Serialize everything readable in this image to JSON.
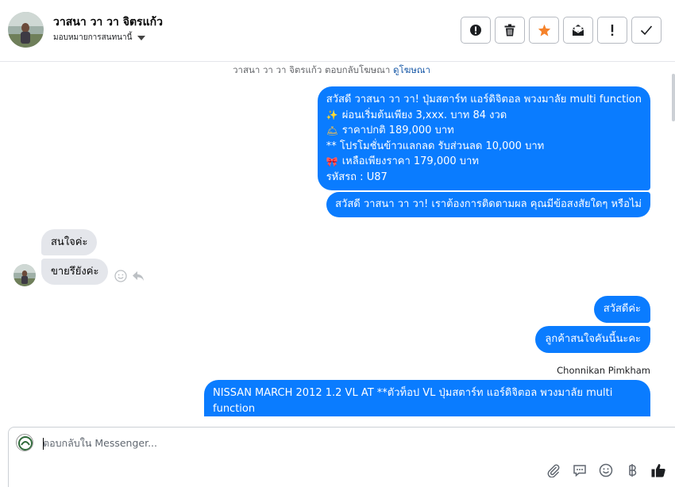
{
  "header": {
    "contact_name": "วาสนา วา วา จิตรแก้ว",
    "assign_label": "มอบหมายการสนทนานี้",
    "toolbar": [
      {
        "name": "report-spam-button",
        "icon": "alert-circle-icon"
      },
      {
        "name": "delete-button",
        "icon": "trash-icon"
      },
      {
        "name": "star-button",
        "icon": "star-icon"
      },
      {
        "name": "mark-unread-button",
        "icon": "envelope-icon"
      },
      {
        "name": "follow-up-button",
        "icon": "exclamation-icon"
      },
      {
        "name": "mark-done-button",
        "icon": "check-icon"
      }
    ]
  },
  "chat": {
    "ad_notice": {
      "text": "วาสนา วา วา จิตรแก้ว ตอบกลับโฆษณา ",
      "link": "ดูโฆษณา"
    },
    "messages": {
      "m1": {
        "lines": [
          "สวัสดี วาสนา วา วา! ปุ่มสตาร์ท แอร์ดิจิตอล พวงมาลัย multi function",
          "ผ่อนเริ่มต้นเพียง 3,xxx. บาท 84 งวด",
          "ราคาปกติ 189,000 บาท",
          "** โปรโมชั่นข้าวแลกลด รับส่วนลด 10,000 บาท",
          " เหลือเพียงราคา 179,000 บาท",
          " รหัสรถ : U87"
        ],
        "emoji": [
          "✨",
          "🛎",
          "🎀"
        ]
      },
      "m2": "สวัสดี วาสนา วา วา! เราต้องการติดตามผล คุณมีข้อสงสัยใดๆ หรือไม่",
      "m3": "สนใจค่ะ",
      "m4": "ขายรึยังค่ะ",
      "m5": "สวัสดีค่ะ",
      "m6": "ลูกค้าสนใจคันนี้นะคะ",
      "sender_label": "Chonnikan Pimkham",
      "m7": "NISSAN MARCH 2012 1.2 VL AT **ตัวท็อป VL ปุ่มสตาร์ท แอร์ดิจิตอล พวงมาลัย multi function"
    }
  },
  "composer": {
    "placeholder": "ตอบกลับใน Messenger...",
    "tools": [
      "paperclip-icon",
      "chat-bubble-icon",
      "smiley-icon",
      "baht-icon",
      "thumbs-up-icon"
    ]
  },
  "colors": {
    "outgoing_bubble": "#0a7cff",
    "incoming_bubble": "#e4e6eb",
    "star": "#f5822a"
  }
}
